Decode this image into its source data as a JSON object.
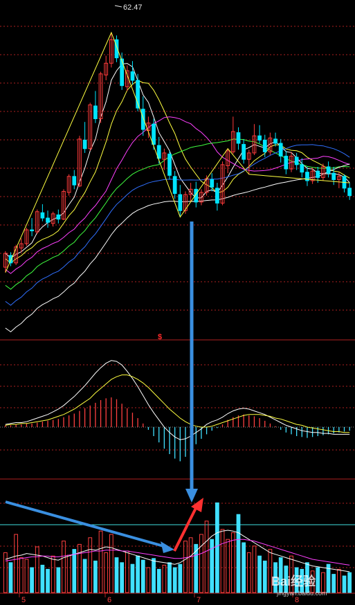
{
  "chart_data": [
    {
      "type": "candlestick",
      "panel": "price",
      "peak_label": "62.47",
      "peak_value": 62.47,
      "colors": {
        "up": "#ff3b3b",
        "down": "#00e5ff",
        "grid": "#b0201f"
      },
      "moving_average_colors": [
        "#ffffff",
        "#ffff40",
        "#ff40ff",
        "#40ff40",
        "#3070ff",
        "#ffffff"
      ],
      "candles": [
        [
          40.5,
          42.0,
          40.0,
          41.8
        ],
        [
          41.6,
          41.9,
          40.6,
          40.9
        ],
        [
          40.9,
          42.6,
          40.7,
          42.4
        ],
        [
          42.3,
          43.2,
          41.9,
          42.7
        ],
        [
          42.7,
          44.2,
          42.5,
          44.0
        ],
        [
          44.0,
          45.1,
          43.4,
          43.9
        ],
        [
          43.8,
          45.9,
          43.6,
          45.7
        ],
        [
          45.6,
          46.4,
          44.8,
          45.1
        ],
        [
          45.1,
          45.8,
          44.2,
          44.7
        ],
        [
          44.6,
          45.7,
          44.3,
          45.5
        ],
        [
          45.4,
          45.9,
          44.6,
          45.0
        ],
        [
          45.0,
          47.8,
          44.9,
          47.6
        ],
        [
          47.5,
          49.2,
          47.2,
          49.0
        ],
        [
          49.0,
          49.6,
          47.8,
          48.2
        ],
        [
          48.1,
          52.8,
          48.0,
          52.5
        ],
        [
          52.4,
          54.1,
          51.2,
          51.6
        ],
        [
          51.6,
          55.9,
          51.4,
          55.7
        ],
        [
          55.6,
          57.0,
          54.0,
          54.4
        ],
        [
          54.4,
          58.8,
          54.0,
          58.6
        ],
        [
          58.5,
          60.3,
          58.0,
          59.6
        ],
        [
          59.6,
          62.47,
          59.2,
          61.8
        ],
        [
          61.8,
          62.2,
          59.7,
          60.1
        ],
        [
          60.0,
          60.6,
          57.1,
          57.5
        ],
        [
          57.4,
          59.4,
          57.0,
          58.9
        ],
        [
          58.8,
          59.8,
          57.6,
          58.0
        ],
        [
          58.0,
          58.6,
          55.1,
          55.4
        ],
        [
          55.3,
          56.5,
          52.8,
          53.4
        ],
        [
          53.3,
          54.6,
          52.6,
          54.0
        ],
        [
          53.9,
          54.4,
          51.5,
          52.0
        ],
        [
          51.9,
          52.7,
          50.2,
          50.7
        ],
        [
          50.6,
          51.6,
          49.6,
          51.2
        ],
        [
          51.1,
          51.4,
          48.7,
          49.1
        ],
        [
          49.0,
          49.5,
          46.9,
          47.4
        ],
        [
          47.3,
          48.2,
          45.2,
          45.8
        ],
        [
          45.8,
          47.6,
          45.5,
          47.3
        ],
        [
          47.3,
          48.4,
          46.6,
          47.8
        ],
        [
          47.8,
          48.5,
          46.1,
          46.6
        ],
        [
          46.6,
          47.8,
          46.3,
          47.5
        ],
        [
          47.5,
          49.1,
          47.2,
          48.8
        ],
        [
          48.7,
          49.3,
          47.6,
          48.0
        ],
        [
          47.9,
          48.4,
          45.8,
          46.5
        ],
        [
          46.5,
          50.4,
          46.3,
          50.1
        ],
        [
          50.0,
          51.6,
          49.3,
          51.4
        ],
        [
          51.3,
          54.6,
          51.1,
          53.2
        ],
        [
          53.1,
          53.6,
          51.5,
          52.1
        ],
        [
          52.0,
          52.5,
          50.2,
          50.6
        ],
        [
          50.6,
          51.5,
          49.2,
          51.2
        ],
        [
          51.2,
          53.9,
          51.0,
          52.8
        ],
        [
          52.8,
          53.8,
          52.1,
          52.4
        ],
        [
          52.4,
          52.9,
          50.8,
          51.3
        ],
        [
          51.3,
          53.1,
          51.0,
          52.6
        ],
        [
          52.5,
          53.1,
          51.8,
          52.1
        ],
        [
          52.1,
          52.5,
          50.3,
          50.9
        ],
        [
          50.9,
          51.4,
          49.2,
          49.7
        ],
        [
          49.7,
          51.3,
          49.4,
          50.9
        ],
        [
          50.8,
          51.2,
          49.6,
          50.1
        ],
        [
          50.1,
          50.7,
          48.9,
          49.4
        ],
        [
          49.4,
          49.9,
          48.1,
          48.6
        ],
        [
          48.6,
          49.8,
          48.3,
          49.5
        ],
        [
          49.5,
          49.9,
          48.4,
          48.9
        ],
        [
          48.9,
          50.2,
          48.6,
          49.9
        ],
        [
          49.9,
          50.4,
          48.9,
          49.3
        ],
        [
          49.3,
          49.9,
          48.2,
          48.7
        ],
        [
          48.7,
          49.4,
          47.9,
          49.0
        ],
        [
          49.0,
          49.2,
          47.5,
          47.9
        ],
        [
          47.9,
          48.4,
          46.8,
          47.2
        ]
      ],
      "y_range": [
        37,
        65
      ]
    },
    {
      "type": "macd",
      "panel": "indicator",
      "marker_label": "$",
      "histogram": [
        0.2,
        0.2,
        0.3,
        0.3,
        0.4,
        0.4,
        0.5,
        0.6,
        0.7,
        0.8,
        0.9,
        1.1,
        1.3,
        1.5,
        1.8,
        2.1,
        2.4,
        2.7,
        3.0,
        3.2,
        3.3,
        3.1,
        2.6,
        2.1,
        1.6,
        1.0,
        0.4,
        -0.3,
        -1.0,
        -1.7,
        -2.4,
        -3.0,
        -3.5,
        -3.8,
        -3.3,
        -2.6,
        -1.9,
        -1.3,
        -0.8,
        -0.4,
        -0.1,
        0.3,
        0.8,
        1.1,
        1.3,
        1.4,
        1.3,
        1.2,
        1.0,
        0.7,
        0.4,
        0.1,
        -0.3,
        -0.6,
        -0.8,
        -1.0,
        -1.1,
        -1.2,
        -1.1,
        -1.0,
        -0.9,
        -0.8,
        -0.7,
        -0.6,
        -0.5,
        -0.4
      ],
      "dif": [
        0.3,
        0.4,
        0.5,
        0.5,
        0.6,
        0.8,
        1.0,
        1.2,
        1.4,
        1.7,
        2.0,
        2.4,
        2.9,
        3.4,
        4.0,
        4.6,
        5.3,
        6.0,
        6.6,
        7.1,
        7.4,
        7.3,
        6.9,
        6.2,
        5.4,
        4.5,
        3.5,
        2.5,
        1.6,
        0.8,
        0.0,
        -0.6,
        -1.1,
        -1.4,
        -1.3,
        -1.0,
        -0.6,
        -0.2,
        0.3,
        0.6,
        0.8,
        1.1,
        1.5,
        1.8,
        2.0,
        2.1,
        2.0,
        1.8,
        1.6,
        1.4,
        1.1,
        0.8,
        0.5,
        0.2,
        0.0,
        -0.2,
        -0.4,
        -0.5,
        -0.6,
        -0.6,
        -0.7,
        -0.7,
        -0.8,
        -0.8,
        -0.8,
        -0.8
      ],
      "dea": [
        0.2,
        0.3,
        0.3,
        0.4,
        0.4,
        0.5,
        0.6,
        0.7,
        0.8,
        1.0,
        1.2,
        1.4,
        1.7,
        2.0,
        2.4,
        2.8,
        3.2,
        3.8,
        4.3,
        4.8,
        5.3,
        5.6,
        5.8,
        5.8,
        5.6,
        5.3,
        4.9,
        4.4,
        3.8,
        3.2,
        2.6,
        2.0,
        1.5,
        1.0,
        0.6,
        0.3,
        0.1,
        0.0,
        0.0,
        0.1,
        0.3,
        0.5,
        0.7,
        0.9,
        1.1,
        1.3,
        1.4,
        1.4,
        1.4,
        1.3,
        1.2,
        1.0,
        0.9,
        0.7,
        0.5,
        0.3,
        0.2,
        0.0,
        -0.1,
        -0.2,
        -0.3,
        -0.4,
        -0.5,
        -0.5,
        -0.6,
        -0.6
      ],
      "y_range": [
        -6,
        9
      ]
    },
    {
      "type": "bar",
      "panel": "volume",
      "volumes": [
        48,
        36,
        70,
        42,
        40,
        30,
        55,
        33,
        28,
        44,
        30,
        62,
        45,
        52,
        58,
        40,
        66,
        38,
        74,
        48,
        70,
        42,
        36,
        50,
        34,
        44,
        39,
        30,
        41,
        28,
        33,
        36,
        30,
        34,
        62,
        66,
        58,
        70,
        86,
        64,
        108,
        76,
        64,
        72,
        94,
        60,
        48,
        56,
        44,
        38,
        52,
        36,
        42,
        32,
        44,
        30,
        28,
        36,
        26,
        30,
        24,
        34,
        22,
        28,
        20,
        24
      ],
      "volume_ma5": [
        40,
        42,
        44,
        45,
        47,
        46,
        45,
        44,
        42,
        40,
        39,
        42,
        44,
        46,
        48,
        50,
        52,
        51,
        53,
        55,
        54,
        52,
        50,
        48,
        46,
        44,
        42,
        40,
        38,
        37,
        36,
        35,
        34,
        36,
        40,
        44,
        50,
        56,
        62,
        68,
        72,
        74,
        75,
        74,
        72,
        68,
        64,
        60,
        56,
        52,
        48,
        46,
        44,
        42,
        40,
        38,
        36,
        34,
        32,
        31,
        30,
        29,
        28,
        27,
        26,
        25
      ],
      "volume_ma10": [
        38,
        39,
        40,
        41,
        42,
        43,
        43,
        44,
        44,
        43,
        43,
        44,
        45,
        46,
        47,
        48,
        49,
        50,
        50,
        51,
        51,
        51,
        50,
        50,
        49,
        48,
        47,
        46,
        45,
        44,
        43,
        42,
        41,
        41,
        42,
        43,
        45,
        47,
        50,
        53,
        56,
        59,
        61,
        63,
        64,
        64,
        63,
        62,
        60,
        58,
        56,
        54,
        52,
        50,
        48,
        46,
        44,
        42,
        40,
        39,
        38,
        37,
        36,
        35,
        34,
        33
      ],
      "y_range": [
        0,
        130
      ],
      "x_tick_labels": [
        "5",
        "6",
        "7",
        "8"
      ]
    }
  ],
  "annotations": {
    "blue_arrow_colors": "#3a8fe0",
    "red_arrow_color": "#ff3030"
  },
  "watermark": {
    "text": "Bai经验",
    "subtext": "jingyan.baidu.com"
  }
}
